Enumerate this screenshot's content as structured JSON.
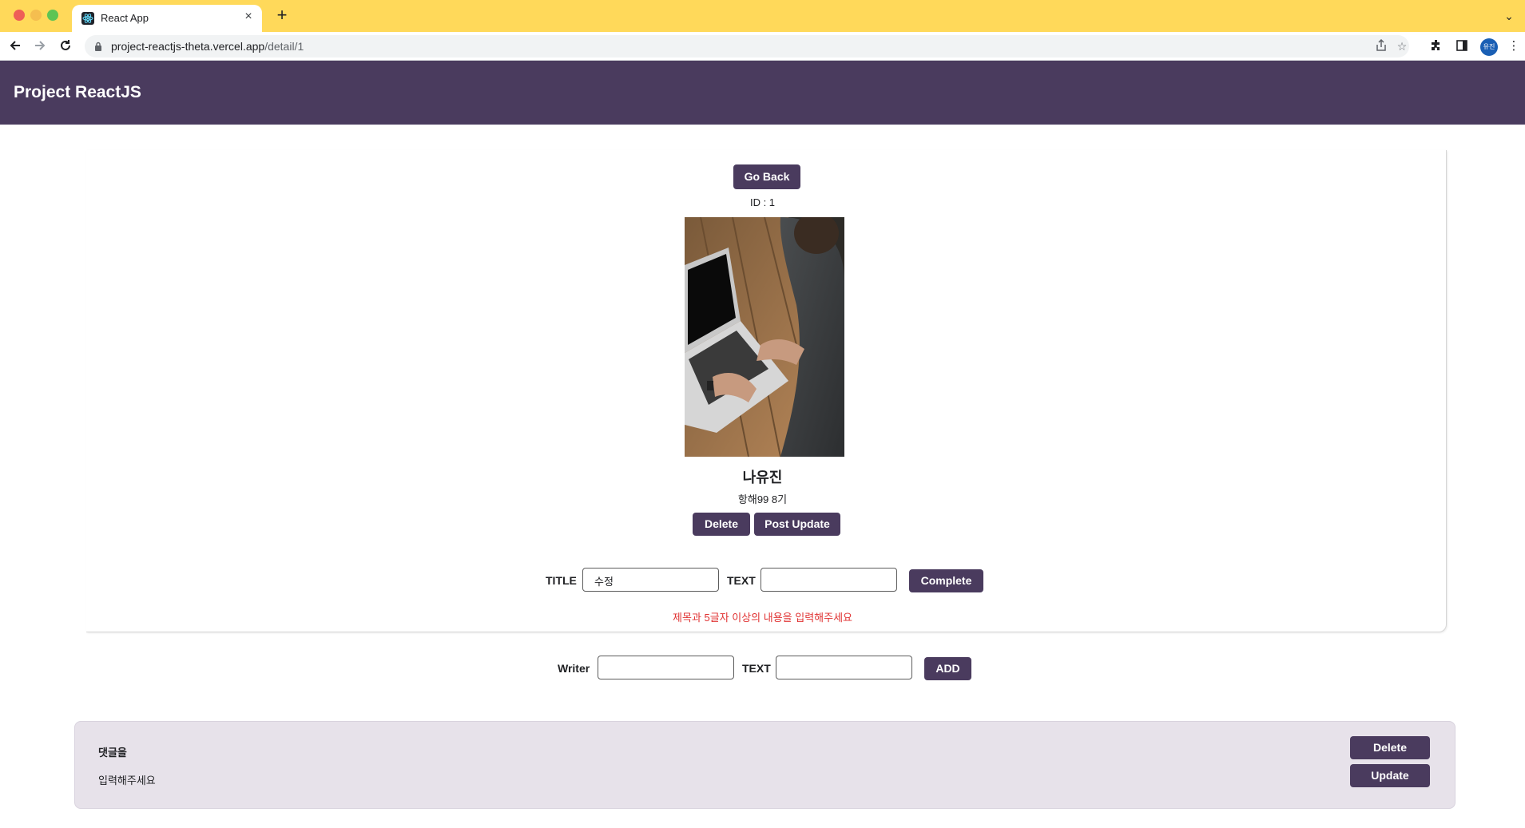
{
  "browser": {
    "tab_title": "React App",
    "tab_close": "×",
    "new_tab": "+",
    "tab_list": "⌄",
    "url_host": "project-reactjs-theta.vercel.app",
    "url_path": "/detail/1",
    "profile_initials": "유진",
    "icons": [
      "back-arrow-icon",
      "forward-arrow-icon",
      "reload-icon",
      "lock-icon",
      "share-icon",
      "star-icon",
      "extensions-icon",
      "side-panel-icon",
      "menu-kebab-icon"
    ]
  },
  "header": {
    "title": "Project ReactJS"
  },
  "detail": {
    "go_back_label": "Go Back",
    "id_text": "ID : 1",
    "name": "나유진",
    "subtitle": "항해99 8기",
    "delete_label": "Delete",
    "post_update_label": "Post Update"
  },
  "edit_form": {
    "title_label": "TITLE",
    "title_value": "수정",
    "text_label": "TEXT",
    "text_value": "",
    "complete_label": "Complete",
    "error_message": "제목과 5글자 이상의 내용을 입력해주세요"
  },
  "comment_form": {
    "writer_label": "Writer",
    "writer_value": "",
    "text_label": "TEXT",
    "text_value": "",
    "add_label": "ADD"
  },
  "comments": [
    {
      "title": "댓글을",
      "body": "입력해주세요",
      "delete_label": "Delete",
      "update_label": "Update"
    }
  ],
  "colors": {
    "tabbar": "#ffd95a",
    "header": "#4a3b5e",
    "button": "#4a3b5e",
    "comment_bg": "#e7e2ea",
    "error": "#e03131"
  }
}
